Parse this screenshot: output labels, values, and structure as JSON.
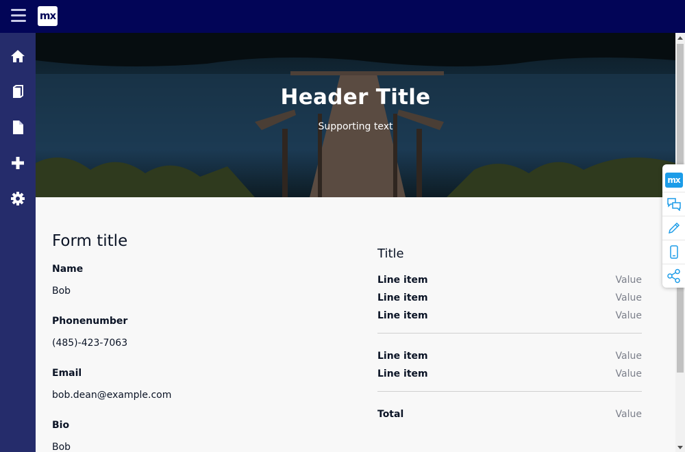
{
  "app": {
    "logo_text": "mx",
    "accent": "#020557",
    "sidebar_color": "#252c6b"
  },
  "header": {
    "title": "Header Title",
    "subtitle": "Supporting text"
  },
  "sidebar": {
    "items": [
      {
        "icon": "home-icon"
      },
      {
        "icon": "book-icon"
      },
      {
        "icon": "document-icon"
      },
      {
        "icon": "plus-icon"
      },
      {
        "icon": "gear-icon"
      }
    ]
  },
  "form": {
    "title": "Form title",
    "fields": [
      {
        "label": "Name",
        "value": "Bob"
      },
      {
        "label": "Phonenumber",
        "value": "(485)-423-7063"
      },
      {
        "label": "Email",
        "value": "bob.dean@example.com"
      },
      {
        "label": "Bio",
        "value": "Bob"
      }
    ]
  },
  "summary": {
    "title": "Title",
    "group1": [
      {
        "label": "Line item",
        "value": "Value"
      },
      {
        "label": "Line item",
        "value": "Value"
      },
      {
        "label": "Line item",
        "value": "Value"
      }
    ],
    "group2": [
      {
        "label": "Line item",
        "value": "Value"
      },
      {
        "label": "Line item",
        "value": "Value"
      }
    ],
    "total": {
      "label": "Total",
      "value": "Value"
    }
  },
  "floating_panel": {
    "logo_text": "mx",
    "items": [
      "mendix-logo-icon",
      "chat-icon",
      "pencil-icon",
      "mobile-icon",
      "share-icon"
    ]
  }
}
